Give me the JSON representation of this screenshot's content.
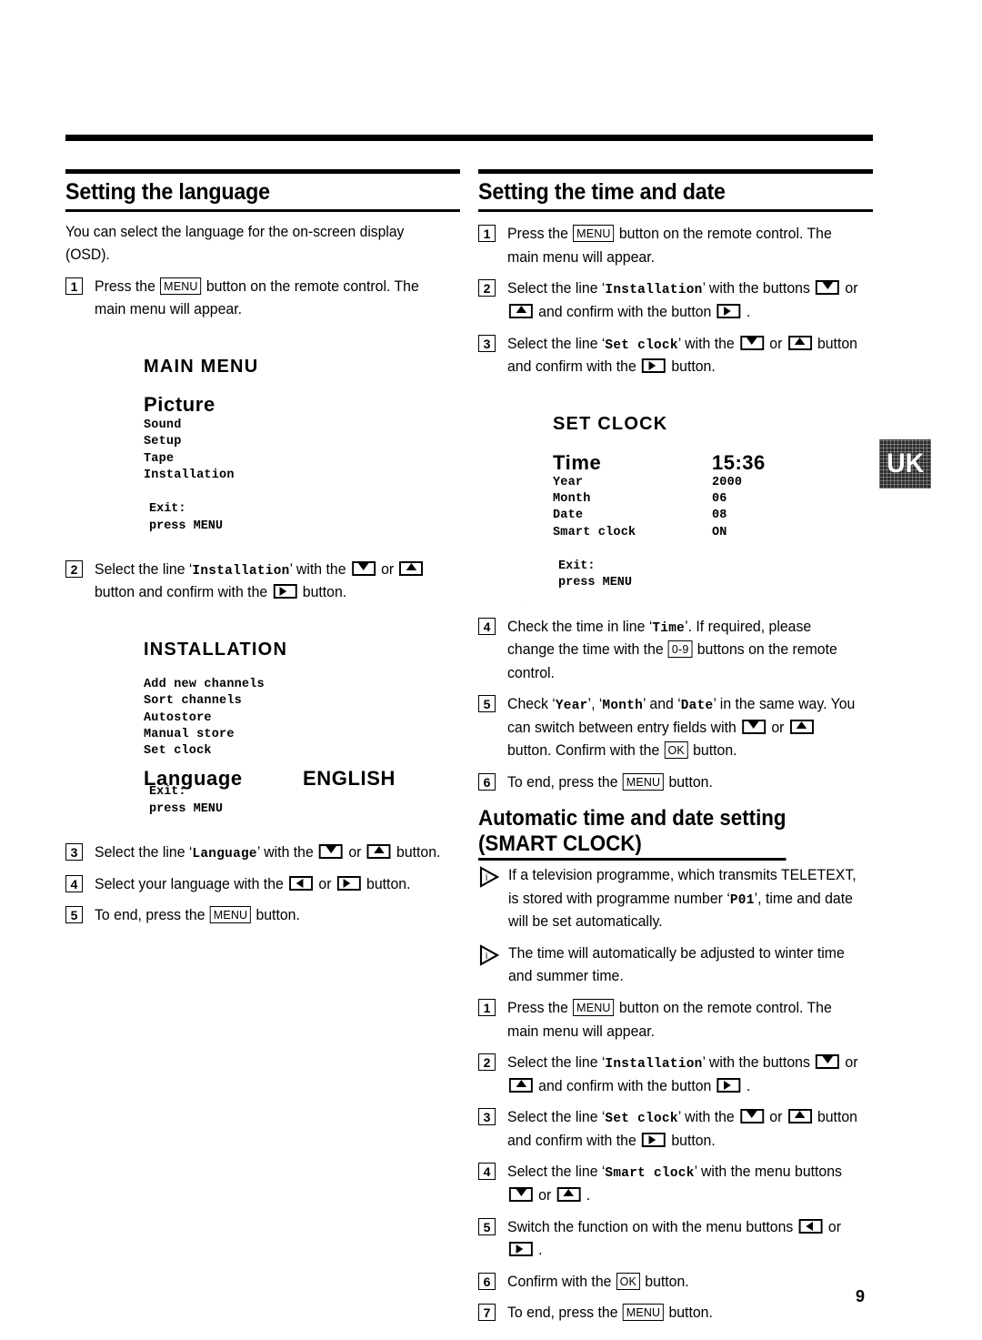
{
  "page": {
    "number": "9",
    "locale_tab": "UK"
  },
  "left_column": {
    "heading": "Setting the language",
    "intro": "You can select the language for the on-screen display (OSD).",
    "steps_before_screens": [
      {
        "num": "1",
        "parts": [
          {
            "t": "text",
            "v": "Press the "
          },
          {
            "t": "key",
            "v": "MENU"
          },
          {
            "t": "text",
            "v": " button on the remote control. The main menu will appear."
          }
        ]
      }
    ],
    "step_2": {
      "num": "2",
      "parts": [
        {
          "t": "text",
          "v": "Select the line ‘"
        },
        {
          "t": "osd",
          "v": "Installation"
        },
        {
          "t": "text",
          "v": "’ with the "
        },
        {
          "t": "btn",
          "v": "down-arrow"
        },
        {
          "t": "text",
          "v": " or "
        },
        {
          "t": "btn",
          "v": "up-arrow"
        },
        {
          "t": "text",
          "v": " button and confirm with the "
        },
        {
          "t": "btn",
          "v": "right-arrow"
        },
        {
          "t": "text",
          "v": " button."
        }
      ]
    },
    "steps_after_screens": [
      {
        "num": "3",
        "parts": [
          {
            "t": "text",
            "v": "Select the line ‘"
          },
          {
            "t": "osd",
            "v": "Language"
          },
          {
            "t": "text",
            "v": "’ with the "
          },
          {
            "t": "btn",
            "v": "down-arrow"
          },
          {
            "t": "text",
            "v": " or "
          },
          {
            "t": "btn",
            "v": "up-arrow"
          },
          {
            "t": "text",
            "v": " button."
          }
        ]
      },
      {
        "num": "4",
        "parts": [
          {
            "t": "text",
            "v": "Select your language with the "
          },
          {
            "t": "btn",
            "v": "left-arrow"
          },
          {
            "t": "text",
            "v": " or "
          },
          {
            "t": "btn",
            "v": "right-arrow"
          },
          {
            "t": "text",
            "v": " button."
          }
        ]
      },
      {
        "num": "5",
        "parts": [
          {
            "t": "text",
            "v": "To end, press the "
          },
          {
            "t": "key",
            "v": "MENU"
          },
          {
            "t": "text",
            "v": " button."
          }
        ]
      }
    ],
    "screen_main_menu": {
      "title": "MAIN MENU",
      "highlight": "Picture",
      "items": [
        "Sound",
        "Setup",
        "Tape",
        "Installation"
      ],
      "exit_label": "Exit:",
      "exit_action": "press MENU"
    },
    "screen_installation": {
      "title": "INSTALLATION",
      "items": [
        "Add new channels",
        "Sort channels",
        "Autostore",
        "Manual store",
        "Set clock"
      ],
      "language_label": "Language",
      "language_value": "ENGLISH",
      "exit_label": "Exit:",
      "exit_action": "press MENU"
    }
  },
  "right_column": {
    "heading": "Setting the time and date",
    "steps_before_screen": [
      {
        "num": "1",
        "parts": [
          {
            "t": "text",
            "v": "Press the "
          },
          {
            "t": "key",
            "v": "MENU"
          },
          {
            "t": "text",
            "v": " button on the remote control. The main menu will appear."
          }
        ]
      },
      {
        "num": "2",
        "parts": [
          {
            "t": "text",
            "v": "Select the line ‘"
          },
          {
            "t": "osd",
            "v": "Installation"
          },
          {
            "t": "text",
            "v": "’ with the buttons "
          },
          {
            "t": "btn",
            "v": "down-arrow"
          },
          {
            "t": "text",
            "v": " or "
          },
          {
            "t": "btn",
            "v": "up-arrow"
          },
          {
            "t": "text",
            "v": " and confirm with the button "
          },
          {
            "t": "btn",
            "v": "right-arrow"
          },
          {
            "t": "text",
            "v": " ."
          }
        ]
      },
      {
        "num": "3",
        "parts": [
          {
            "t": "text",
            "v": "Select the line ‘"
          },
          {
            "t": "osd",
            "v": "Set clock"
          },
          {
            "t": "text",
            "v": "’ with the "
          },
          {
            "t": "btn",
            "v": "down-arrow"
          },
          {
            "t": "text",
            "v": " or "
          },
          {
            "t": "btn",
            "v": "up-arrow"
          },
          {
            "t": "text",
            "v": " button and confirm with the "
          },
          {
            "t": "btn",
            "v": "right-arrow"
          },
          {
            "t": "text",
            "v": " button."
          }
        ]
      }
    ],
    "screen_set_clock": {
      "title": "SET CLOCK",
      "time_label": "Time",
      "time_value": "15:36",
      "rows": [
        {
          "label": "Year",
          "value": "2000"
        },
        {
          "label": "Month",
          "value": "06"
        },
        {
          "label": "Date",
          "value": "08"
        },
        {
          "label": "Smart clock",
          "value": "ON"
        }
      ],
      "exit_label": "Exit:",
      "exit_action": "press MENU"
    },
    "steps_after_screen": [
      {
        "num": "4",
        "parts": [
          {
            "t": "text",
            "v": "Check the time in line ‘"
          },
          {
            "t": "osd",
            "v": "Time"
          },
          {
            "t": "text",
            "v": "’. If required, please change the time with the "
          },
          {
            "t": "key",
            "v": "0-9"
          },
          {
            "t": "text",
            "v": " buttons on the remote control."
          }
        ]
      },
      {
        "num": "5",
        "parts": [
          {
            "t": "text",
            "v": "Check ‘"
          },
          {
            "t": "osd",
            "v": "Year"
          },
          {
            "t": "text",
            "v": "’, ‘"
          },
          {
            "t": "osd",
            "v": "Month"
          },
          {
            "t": "text",
            "v": "’ and ‘"
          },
          {
            "t": "osd",
            "v": "Date"
          },
          {
            "t": "text",
            "v": "’ in the same way. You can switch between entry fields with "
          },
          {
            "t": "btn",
            "v": "down-arrow"
          },
          {
            "t": "text",
            "v": " or "
          },
          {
            "t": "btn",
            "v": "up-arrow"
          },
          {
            "t": "text",
            "v": " button. Confirm with the "
          },
          {
            "t": "key",
            "v": "OK"
          },
          {
            "t": "text",
            "v": " button."
          }
        ]
      },
      {
        "num": "6",
        "parts": [
          {
            "t": "text",
            "v": "To end, press the "
          },
          {
            "t": "key",
            "v": "MENU"
          },
          {
            "t": "text",
            "v": " button."
          }
        ]
      }
    ],
    "smart_clock": {
      "heading_line_1": "Automatic time and date setting",
      "heading_line_2": "(SMART CLOCK)",
      "notes": [
        {
          "parts": [
            {
              "t": "text",
              "v": "If a television programme, which transmits TELETEXT, is stored with programme number ‘"
            },
            {
              "t": "osd",
              "v": "P01"
            },
            {
              "t": "text",
              "v": "’, time and date will be set automatically."
            }
          ]
        },
        {
          "parts": [
            {
              "t": "text",
              "v": "The time will automatically be adjusted to winter time and summer time."
            }
          ]
        }
      ],
      "steps": [
        {
          "num": "1",
          "parts": [
            {
              "t": "text",
              "v": "Press the "
            },
            {
              "t": "key",
              "v": "MENU"
            },
            {
              "t": "text",
              "v": " button on the remote control. The main menu will appear."
            }
          ]
        },
        {
          "num": "2",
          "parts": [
            {
              "t": "text",
              "v": "Select the line ‘"
            },
            {
              "t": "osd",
              "v": "Installation"
            },
            {
              "t": "text",
              "v": "’ with the buttons "
            },
            {
              "t": "btn",
              "v": "down-arrow"
            },
            {
              "t": "text",
              "v": " or "
            },
            {
              "t": "btn",
              "v": "up-arrow"
            },
            {
              "t": "text",
              "v": " and confirm with the button "
            },
            {
              "t": "btn",
              "v": "right-arrow"
            },
            {
              "t": "text",
              "v": " ."
            }
          ]
        },
        {
          "num": "3",
          "parts": [
            {
              "t": "text",
              "v": "Select the line ‘"
            },
            {
              "t": "osd",
              "v": "Set clock"
            },
            {
              "t": "text",
              "v": "’ with the "
            },
            {
              "t": "btn",
              "v": "down-arrow"
            },
            {
              "t": "text",
              "v": " or "
            },
            {
              "t": "btn",
              "v": "up-arrow"
            },
            {
              "t": "text",
              "v": " button and confirm with the "
            },
            {
              "t": "btn",
              "v": "right-arrow"
            },
            {
              "t": "text",
              "v": " button."
            }
          ]
        },
        {
          "num": "4",
          "parts": [
            {
              "t": "text",
              "v": "Select the line ‘"
            },
            {
              "t": "osd",
              "v": "Smart clock"
            },
            {
              "t": "text",
              "v": "’ with the menu buttons "
            },
            {
              "t": "btn",
              "v": "down-arrow"
            },
            {
              "t": "text",
              "v": " or "
            },
            {
              "t": "btn",
              "v": "up-arrow"
            },
            {
              "t": "text",
              "v": " ."
            }
          ]
        },
        {
          "num": "5",
          "parts": [
            {
              "t": "text",
              "v": "Switch the function on with the menu buttons "
            },
            {
              "t": "btn",
              "v": "left-arrow"
            },
            {
              "t": "text",
              "v": " or "
            },
            {
              "t": "btn",
              "v": "right-arrow"
            },
            {
              "t": "text",
              "v": " ."
            }
          ]
        },
        {
          "num": "6",
          "parts": [
            {
              "t": "text",
              "v": "Confirm with the "
            },
            {
              "t": "key",
              "v": "OK"
            },
            {
              "t": "text",
              "v": " button."
            }
          ]
        },
        {
          "num": "7",
          "parts": [
            {
              "t": "text",
              "v": "To end, press the "
            },
            {
              "t": "key",
              "v": "MENU"
            },
            {
              "t": "text",
              "v": " button."
            }
          ]
        }
      ]
    }
  }
}
